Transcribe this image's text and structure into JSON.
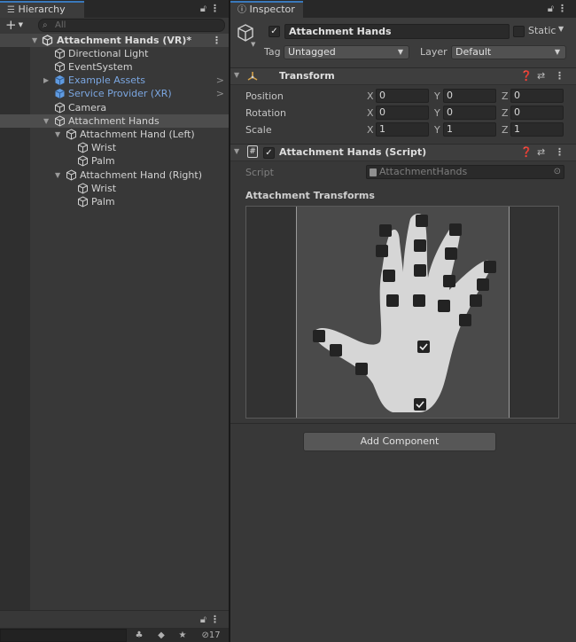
{
  "hierarchy": {
    "tab_label": "Hierarchy",
    "search_placeholder": "All",
    "items": [
      {
        "label": "Attachment Hands (VR)*",
        "depth": 0
      },
      {
        "label": "Directional Light",
        "depth": 1
      },
      {
        "label": "EventSystem",
        "depth": 1
      },
      {
        "label": "Example Assets",
        "depth": 1
      },
      {
        "label": "Service Provider (XR)",
        "depth": 1
      },
      {
        "label": "Camera",
        "depth": 1
      },
      {
        "label": "Attachment Hands",
        "depth": 1
      },
      {
        "label": "Attachment Hand (Left)",
        "depth": 2
      },
      {
        "label": "Wrist",
        "depth": 3
      },
      {
        "label": "Palm",
        "depth": 3
      },
      {
        "label": "Attachment Hand (Right)",
        "depth": 2
      },
      {
        "label": "Wrist",
        "depth": 3
      },
      {
        "label": "Palm",
        "depth": 3
      }
    ],
    "hidden_count": "17"
  },
  "inspector": {
    "tab_label": "Inspector",
    "object_name": "Attachment Hands",
    "static_label": "Static",
    "tag_label": "Tag",
    "tag_value": "Untagged",
    "layer_label": "Layer",
    "layer_value": "Default",
    "transform": {
      "title": "Transform",
      "rows": [
        {
          "label": "Position",
          "x": "0",
          "y": "0",
          "z": "0"
        },
        {
          "label": "Rotation",
          "x": "0",
          "y": "0",
          "z": "0"
        },
        {
          "label": "Scale",
          "x": "1",
          "y": "1",
          "z": "1"
        }
      ],
      "axis_labels": [
        "X",
        "Y",
        "Z"
      ]
    },
    "script_component": {
      "title": "Attachment Hands (Script)",
      "script_label": "Script",
      "script_value": "AttachmentHands",
      "section_label": "Attachment Transforms"
    },
    "add_component_label": "Add Component"
  },
  "colors": {
    "accent_tab": "#3a79bb",
    "prefab_blue": "#7ba6e0",
    "hand_fill": "#d6d6d6"
  }
}
